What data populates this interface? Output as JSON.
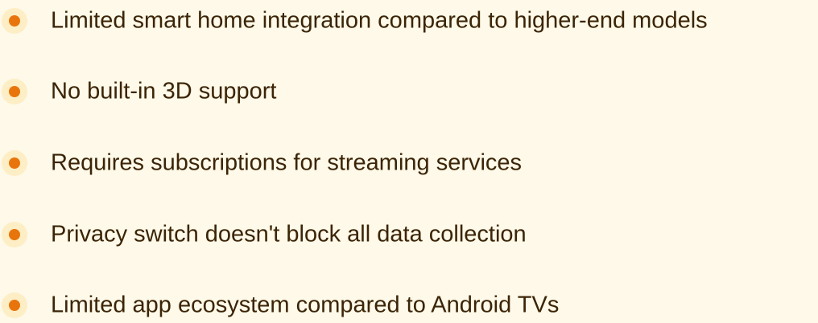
{
  "list": {
    "items": [
      {
        "text": "Limited smart home integration compared to higher-end models",
        "icon": "bullet-dot-icon"
      },
      {
        "text": "No built-in 3D support",
        "icon": "bullet-dot-icon"
      },
      {
        "text": "Requires subscriptions for streaming services",
        "icon": "bullet-dot-icon"
      },
      {
        "text": "Privacy switch doesn't block all data collection",
        "icon": "bullet-dot-icon"
      },
      {
        "text": "Limited app ecosystem compared to Android TVs",
        "icon": "bullet-dot-icon"
      }
    ]
  },
  "colors": {
    "background": "#fef9e8",
    "bullet": "#e8750c",
    "bullet_halo": "#fdeec6",
    "text": "#3b2407"
  }
}
